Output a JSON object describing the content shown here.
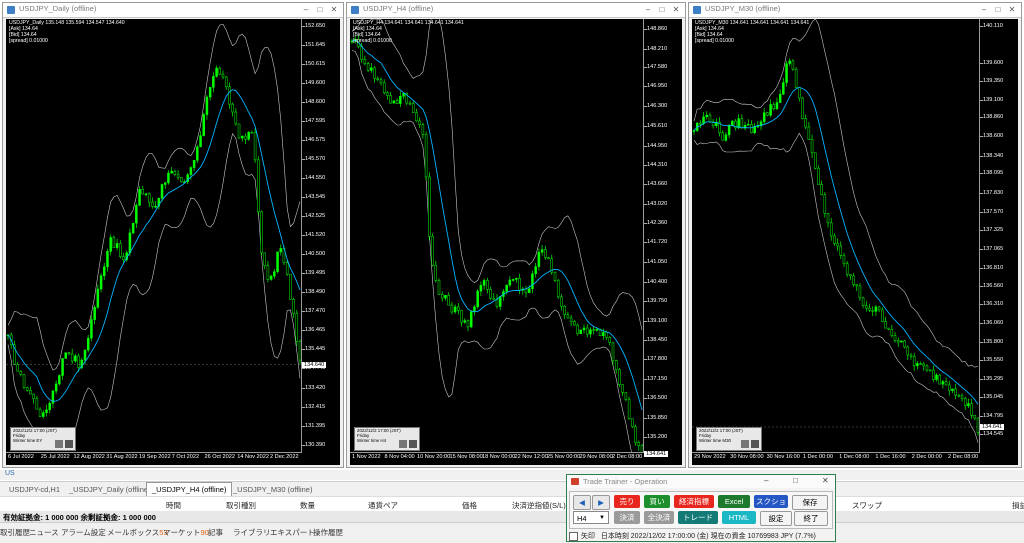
{
  "windows": [
    {
      "id": "daily",
      "title": "USDJPY_Daily (offline)",
      "info": [
        "USDJPY_Daily  135.148 135.594 134.547 134.640",
        "[Ask] 134.64",
        "[Bid] 134.64",
        "[spread] 0.01000"
      ],
      "ymin": 130.0,
      "ymax": 153.0,
      "yticks": [
        "152.650",
        "151.645",
        "150.615",
        "149.600",
        "148.600",
        "147.595",
        "146.575",
        "145.570",
        "144.550",
        "143.545",
        "142.525",
        "141.520",
        "140.500",
        "139.495",
        "138.490",
        "137.470",
        "136.465",
        "135.445",
        "134.440",
        "133.420",
        "132.415",
        "131.395",
        "130.390"
      ],
      "xticks": [
        "6 Jul 2022",
        "25 Jul 2022",
        "12 Aug 2022",
        "31 Aug 2022",
        "19 Sep 2022",
        "7 Oct 2022",
        "26 Oct 2022",
        "14 Nov 2022",
        "2 Dec 2022"
      ],
      "price": "134.640",
      "minibox": [
        "2022/12/2 17:00 (JST)",
        "Friday",
        "Winter time     EY"
      ],
      "path": [
        [
          0,
          136.0
        ],
        [
          4,
          134.0
        ],
        [
          8,
          133.0
        ],
        [
          12,
          131.8
        ],
        [
          16,
          133.5
        ],
        [
          20,
          135.5
        ],
        [
          25,
          134.5
        ],
        [
          30,
          138.0
        ],
        [
          35,
          141.5
        ],
        [
          40,
          140.0
        ],
        [
          45,
          144.0
        ],
        [
          50,
          143.0
        ],
        [
          55,
          145.0
        ],
        [
          60,
          144.0
        ],
        [
          65,
          146.0
        ],
        [
          68,
          149.0
        ],
        [
          72,
          150.5
        ],
        [
          76,
          148.5
        ],
        [
          80,
          146.5
        ],
        [
          84,
          147.0
        ],
        [
          87,
          140.0
        ],
        [
          90,
          139.0
        ],
        [
          93,
          141.0
        ],
        [
          96,
          139.0
        ],
        [
          99,
          136.0
        ],
        [
          100,
          134.6
        ]
      ]
    },
    {
      "id": "h4",
      "title": "USDJPY_H4 (offline)",
      "info": [
        "USDJPY_H4  134.641 134.641 134.641 134.641",
        "[Ask] 134.64",
        "[Bid] 134.64",
        "[spread] 0.01000"
      ],
      "ymin": 134.7,
      "ymax": 149.2,
      "yticks": [
        "148.860",
        "148.210",
        "147.580",
        "146.950",
        "146.300",
        "145.610",
        "144.950",
        "144.310",
        "143.660",
        "143.020",
        "142.360",
        "141.720",
        "141.050",
        "140.400",
        "139.750",
        "139.100",
        "138.450",
        "137.800",
        "137.150",
        "136.500",
        "135.850",
        "135.200"
      ],
      "xticks": [
        "1 Nov 2022",
        "8 Nov 04:00",
        "10 Nov 20:00",
        "15 Nov 08:00",
        "18 Nov 00:00",
        "22 Nov 12:00",
        "25 Nov 00:00",
        "29 Nov 08:00",
        "2 Dec 08:00"
      ],
      "price": "134.641",
      "minibox": [
        "2022/12/2 17:00 (JST)",
        "Friday",
        "Winter time     H4"
      ],
      "path": [
        [
          0,
          148.6
        ],
        [
          5,
          147.7
        ],
        [
          10,
          147.0
        ],
        [
          14,
          146.4
        ],
        [
          18,
          146.6
        ],
        [
          22,
          146.0
        ],
        [
          25,
          145.2
        ],
        [
          27,
          141.2
        ],
        [
          30,
          140.0
        ],
        [
          35,
          139.5
        ],
        [
          40,
          139.0
        ],
        [
          45,
          140.4
        ],
        [
          50,
          139.7
        ],
        [
          55,
          140.6
        ],
        [
          60,
          140.0
        ],
        [
          65,
          141.5
        ],
        [
          68,
          141.2
        ],
        [
          72,
          139.5
        ],
        [
          76,
          138.9
        ],
        [
          80,
          138.7
        ],
        [
          84,
          138.8
        ],
        [
          88,
          138.5
        ],
        [
          91,
          137.5
        ],
        [
          94,
          136.5
        ],
        [
          97,
          135.4
        ],
        [
          100,
          134.6
        ]
      ]
    },
    {
      "id": "m30",
      "title": "USDJPY_M30 (offline)",
      "info": [
        "USDJPY_M30  134.641 134.641 134.641 134.641",
        "[Ask] 134.64",
        "[Bid] 134.64",
        "[spread] 0.01000"
      ],
      "ymin": 134.3,
      "ymax": 140.2,
      "yticks": [
        "140.110",
        "139.600",
        "139.350",
        "139.100",
        "138.860",
        "138.600",
        "138.340",
        "138.095",
        "137.830",
        "137.570",
        "137.325",
        "137.065",
        "136.810",
        "136.560",
        "136.310",
        "136.060",
        "135.800",
        "135.550",
        "135.295",
        "135.045",
        "134.795",
        "134.545"
      ],
      "xticks": [
        "29 Nov 2022",
        "30 Nov 08:00",
        "30 Nov 16:00",
        "1 Dec 00:00",
        "1 Dec 08:00",
        "1 Dec 16:00",
        "2 Dec 00:00",
        "2 Dec 08:00"
      ],
      "price": "134.641",
      "minibox": [
        "2022/12/2 17:00 (JST)",
        "Friday",
        "Winter time     M30"
      ],
      "path": [
        [
          0,
          138.7
        ],
        [
          5,
          138.9
        ],
        [
          10,
          138.6
        ],
        [
          15,
          138.8
        ],
        [
          20,
          138.7
        ],
        [
          25,
          138.9
        ],
        [
          30,
          139.1
        ],
        [
          33,
          139.7
        ],
        [
          36,
          139.3
        ],
        [
          40,
          138.6
        ],
        [
          44,
          137.9
        ],
        [
          48,
          137.3
        ],
        [
          52,
          136.9
        ],
        [
          56,
          136.6
        ],
        [
          60,
          136.3
        ],
        [
          65,
          136.2
        ],
        [
          70,
          135.9
        ],
        [
          74,
          135.7
        ],
        [
          78,
          135.5
        ],
        [
          82,
          135.4
        ],
        [
          86,
          135.3
        ],
        [
          90,
          135.2
        ],
        [
          94,
          135.1
        ],
        [
          97,
          134.9
        ],
        [
          100,
          134.6
        ]
      ]
    }
  ],
  "tabs": [
    "USDJPY-cd,H1",
    "_USDJPY_Daily (offline)",
    "_USDJPY_H4 (offline)",
    "_USDJPY_M30 (offline)"
  ],
  "active_tab": 2,
  "columns": [
    "時間",
    "取引種別",
    "数量",
    "通貨ペア",
    "価格",
    "決済逆指値(S/L)",
    "スワップ",
    "損益"
  ],
  "balance_text": "有効証拠金: 1 000 000  余剰証拠金: 1 000 000",
  "status_left": "US",
  "bottom_tabs": [
    {
      "label": "取引履歴",
      "badge": ""
    },
    {
      "label": "ニュース",
      "badge": ""
    },
    {
      "label": "アラーム設定",
      "badge": ""
    },
    {
      "label": "メールボックス",
      "badge": "53"
    },
    {
      "label": "マーケット",
      "badge": "90"
    },
    {
      "label": "記事",
      "badge": ""
    },
    {
      "label": "ライブラリ",
      "badge": ""
    },
    {
      "label": "エキスパート",
      "badge": ""
    },
    {
      "label": "操作履歴",
      "badge": ""
    }
  ],
  "trade_trainer": {
    "title": "Trade Trainer - Operation",
    "timeframe": "H4",
    "buttons": {
      "prev": "◀",
      "next": "▶",
      "sell": "売り",
      "buy": "買い",
      "economic": "経済指標",
      "excel": "Excel",
      "screenshot": "スクショ",
      "save": "保存",
      "settle": "決済",
      "settle_all": "全決済",
      "trade": "トレード",
      "html": "HTML",
      "settings": "設定",
      "exit": "終了"
    },
    "arrow_label": "矢印",
    "status": "日本時刻 2022/12/02 17:00:00 (金)    現在の資金 10769983 JPY (7.7%)"
  },
  "colors": {
    "candle": "#00ff00",
    "ma": "#00b4ff",
    "band": "#c8c8c8"
  }
}
